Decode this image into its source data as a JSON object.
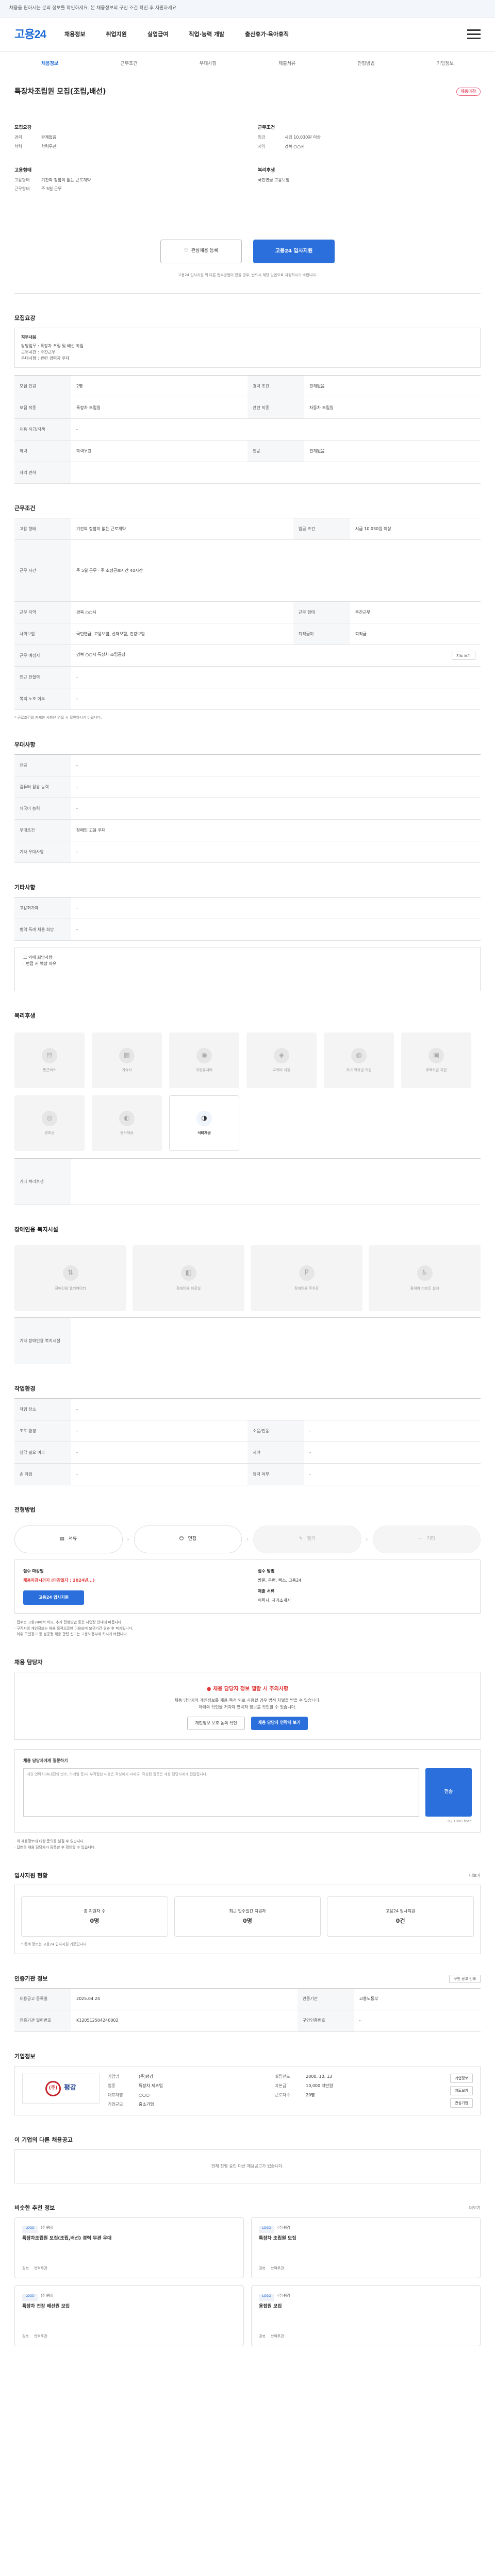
{
  "topbar": {
    "notice": "채용을 원하시는 분의 정보를 확인하세요. 본 채용정보의 구인 조건 확인 후 지원하세요."
  },
  "header": {
    "logo": "고용24",
    "nav": [
      "채용정보",
      "취업지원",
      "실업급여",
      "직업·능력 개발",
      "출산휴가·육아휴직"
    ]
  },
  "subnav": [
    "채용정보",
    "근무조건",
    "우대사항",
    "제출서류",
    "전형방법",
    "기업정보"
  ],
  "job": {
    "title": "특장차조립원 모집(조립,배선)",
    "badge": "채용마감",
    "company_label": "모집요강",
    "summary_left": [
      {
        "k": "경력",
        "v": "관계없음"
      },
      {
        "k": "학력",
        "v": "학력무관"
      }
    ],
    "summary_right_head": "근무조건",
    "summary_right": [
      {
        "k": "임금",
        "v": "시급 10,030원 이상"
      },
      {
        "k": "지역",
        "v": "경북 ○○시"
      }
    ],
    "cond_head": "고용형태",
    "cond": [
      {
        "k": "고용형태",
        "v": "기간의 정함이 없는 근로계약"
      },
      {
        "k": "근무형태",
        "v": "주 5일 근무"
      }
    ],
    "welfare_head": "복리후생",
    "welfare": [
      {
        "k": "",
        "v": "국민연금 고용보험"
      }
    ],
    "like_label": "관심채용 등록",
    "apply_label": "고용24 입사지원",
    "apply_note": "고용24 입사지원 외 다른 접수방법이 있을 경우, 반드시 해당 방법으로 지원하시기 바랍니다."
  },
  "sections": {
    "recruit": "모집요강",
    "conditions": "근무조건",
    "pref": "우대사항",
    "etc": "기타사항",
    "welfare": "복리후생",
    "disabled": "장애인용 복지시설",
    "env": "작업환경",
    "process": "전형방법",
    "manager": "채용 담당자",
    "stats": "입사지원 현황",
    "rel": "인증기관 정보",
    "company": "기업정보",
    "other": "이 기업의 다른 채용공고",
    "reco": "비슷한 추천 정보"
  },
  "recruit_box": {
    "label": "직무내용",
    "items": [
      "담당업무 : 특장차 조립 및 배선 작업",
      "근무시간 : 주간근무",
      "우대사항 : 관련 경력자 우대"
    ]
  },
  "recruit_table": [
    {
      "k1": "모집 인원",
      "v1": "2명",
      "k2": "경력 조건",
      "v2": "관계없음"
    },
    {
      "k1": "모집 직종",
      "v1": "특장차 조립원",
      "k2": "관련 직종",
      "v2": "자동차 조립원"
    },
    {
      "k1": "채용 직급/직책",
      "v1": "-",
      "k2": "",
      "v2": ""
    },
    {
      "k1": "학력",
      "v1": "학력무관",
      "k2": "전공",
      "v2": "관계없음"
    },
    {
      "k1": "자격 면허",
      "v1": "",
      "k2": "",
      "v2": ""
    }
  ],
  "cond_table": [
    {
      "k1": "고용 형태",
      "v1": "기간의 정함이 없는 근로계약",
      "k2": "임금 조건",
      "v2": "시급 10,030원 이상"
    },
    {
      "k1": "근무 시간",
      "v1": "주 5일 근무 · 주 소정근로시간 40시간",
      "k2": "",
      "v2": ""
    },
    {
      "k1": "근무 지역",
      "v1": "경북 ○○시",
      "k2": "근무 형태",
      "v2": "주간근무"
    },
    {
      "k1": "사회보험",
      "v1": "국민연금, 고용보험, 산재보험, 건강보험",
      "k2": "퇴직급여",
      "v2": "퇴직금"
    },
    {
      "k1": "근무 예정지",
      "v1": "경북 ○○시 특장차 조립공장",
      "k2": "",
      "v2": ""
    },
    {
      "k1": "인근 전철역",
      "v1": "-",
      "k2": "",
      "v2": ""
    },
    {
      "k1": "복리 노조 여부",
      "v1": "-",
      "k2": "",
      "v2": ""
    }
  ],
  "cond_map_btn": "지도 보기",
  "cond_note": "* 근로조건의 자세한 사항은 면접 시 확인하시기 바랍니다.",
  "pref_table": [
    {
      "k": "전공",
      "v": "-"
    },
    {
      "k": "컴퓨터 활용 능력",
      "v": "-"
    },
    {
      "k": "외국어 능력",
      "v": "-"
    },
    {
      "k": "우대조건",
      "v": "장애인 고용 우대"
    },
    {
      "k": "기타 우대사항",
      "v": "-"
    }
  ],
  "etc_table": [
    {
      "k": "고용허가제",
      "v": "-"
    },
    {
      "k": "병역 특례 채용 희망",
      "v": "-"
    }
  ],
  "etc_box": [
    "그 외에 희망사항",
    "· 면접 시 복장 자유"
  ],
  "welfare_cards": [
    {
      "icon": "▤",
      "label": "통근버스",
      "on": false
    },
    {
      "icon": "▦",
      "label": "기숙사",
      "on": false
    },
    {
      "icon": "◉",
      "label": "차량유지비",
      "on": false
    },
    {
      "icon": "◈",
      "label": "교육비 지원",
      "on": false
    },
    {
      "icon": "◍",
      "label": "자녀 학자금 지원",
      "on": false
    },
    {
      "icon": "▣",
      "label": "주택자금 지원",
      "on": false
    },
    {
      "icon": "◎",
      "label": "경조금",
      "on": false
    },
    {
      "icon": "◐",
      "label": "중식제공",
      "on": false
    },
    {
      "icon": "◑",
      "label": "식비제공",
      "on": true
    }
  ],
  "welfare_etc_label": "기타 복리후생",
  "disabled_cards": [
    "장애인용 엘리베이터",
    "장애인용 화장실",
    "장애인용 주차장",
    "휠체어 리프트 설치"
  ],
  "disabled_etc_label": "기타 장애인용 복지시설",
  "env_table": [
    {
      "k1": "작업 장소",
      "v1": "-",
      "k2": "",
      "v2": ""
    },
    {
      "k1": "조도 환경",
      "v1": "-",
      "k2": "소음/진동",
      "v2": "-"
    },
    {
      "k1": "청각 필요 여부",
      "v1": "-",
      "k2": "시야",
      "v2": "-"
    },
    {
      "k1": "손 작업",
      "v1": "-",
      "k2": "청력 여부",
      "v2": "-"
    }
  ],
  "process_steps": [
    {
      "label": "서류",
      "off": false
    },
    {
      "label": "면접",
      "off": false
    },
    {
      "label": "필기",
      "off": true
    },
    {
      "label": "기타",
      "off": true
    }
  ],
  "apply": {
    "deadline_label": "접수 마감일",
    "deadline": "채용마감시까지 (마감일자 : 2024년...)",
    "deadline_red": true,
    "method_label": "접수 방법",
    "method": "방문, 우편, 팩스, 고용24",
    "docs_label": "제출 서류",
    "docs": "이력서, 자기소개서",
    "btn": "고용24 입사지원"
  },
  "apply_notes": [
    "· 접수는 고용24에서 하되, 추가 전형방법 등은 사업장 안내에 따릅니다.",
    "· 구직자의 개인정보는 채용 목적으로만 이용되며 보관기간 경과 후 파기됩니다.",
    "· 허위 구인광고 등 불공정 채용 관련 신고는 고용노동부에 하시기 바랍니다."
  ],
  "manager": {
    "warn": "채용 담당자 정보 열람 시 주의사항",
    "desc1": "채용 담당자의 개인정보를 채용 목적 외로 사용할 경우 법적 처벌을 받을 수 있습니다.",
    "desc2": "아래의 확인을 거쳐야 연락처 정보를 확인할 수 있습니다.",
    "btn1": "개인정보 보호 동의 확인",
    "btn2": "채용 담당자 연락처 보기"
  },
  "qa": {
    "label": "채용 담당자에게 질문하기",
    "placeholder": "개인 연락처(휴대전화 번호, 이메일 등)나 부적절한 내용은 작성하지 마세요. 작성된 질문은 채용 담당자에게 전달됩니다.",
    "btn": "전송",
    "count": "0 / 1000 byte"
  },
  "qa_notes": [
    "· 이 채용정보에 대한 문의를 남길 수 있습니다.",
    "· 답변은 채용 담당자가 등록한 후 확인할 수 있습니다."
  ],
  "stats": [
    {
      "label": "총 지원자 수",
      "value": "0명"
    },
    {
      "label": "최근 일주일간 지원자",
      "value": "0명"
    },
    {
      "label": "고용24 입사지원",
      "value": "0건"
    }
  ],
  "stats_more": "더보기",
  "stats_note": "* 통계 정보는 고용24 입사지원 기준입니다.",
  "rel_table": [
    {
      "k1": "채용공고 등록일",
      "v1": "2025.04.24",
      "k2": "인증기관",
      "v2": "고용노동부"
    },
    {
      "k1": "인증기관 일련번호",
      "v1": "K120512504240002",
      "k2": "구인인증번호",
      "v2": "-"
    }
  ],
  "rel_btn": "구인 공고 인쇄",
  "company": {
    "logo_mark": "(주)",
    "logo_name": "평강",
    "rows": [
      {
        "k1": "기업명",
        "v1": "(주)평강",
        "k2": "설립년도",
        "v2": "2000. 10. 13"
      },
      {
        "k1": "업종",
        "v1": "특장차 제조업",
        "k2": "자본금",
        "v2": "10,000 백만원"
      },
      {
        "k1": "대표자명",
        "v1": "○○○",
        "k2": "근로자수",
        "v2": "20명"
      },
      {
        "k1": "기업규모",
        "v1": "중소기업",
        "k2": "",
        "v2": ""
      }
    ],
    "btns": [
      "기업정보",
      "지도보기",
      "관심기업"
    ]
  },
  "other_jobs": "현재 진행 중인 다른 채용공고가 없습니다.",
  "recos": [
    {
      "company": "(주)평강",
      "title": "특장차조립원 모집(조립,배선) 경력 무관 우대",
      "meta": [
        "경북",
        "학력무관"
      ]
    },
    {
      "company": "(주)평강",
      "title": "특장차 조립원 모집",
      "meta": [
        "경북",
        "학력무관"
      ]
    },
    {
      "company": "(주)평강",
      "title": "특장차 전장 배선원 모집",
      "meta": [
        "경북",
        "학력무관"
      ]
    },
    {
      "company": "(주)평강",
      "title": "용접원 모집",
      "meta": [
        "경북",
        "학력무관"
      ]
    }
  ],
  "reco_more": "더보기"
}
